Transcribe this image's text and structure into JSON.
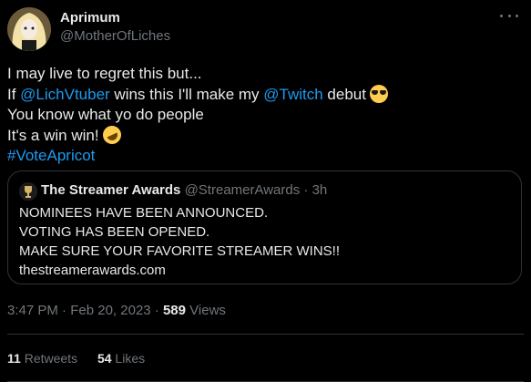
{
  "author": {
    "name": "Aprimum",
    "handle": "@MotherOfLiches"
  },
  "tweet": {
    "line1": "I may live to regret this but...",
    "line2_pre": "If ",
    "line2_link1": "@LichVtuber",
    "line2_mid": " wins this I'll make my ",
    "line2_link2": "@Twitch",
    "line2_post": " debut",
    "line3": "You know what yo do people",
    "line4": "It's a win win!",
    "hashtag": "#VoteApricot"
  },
  "emojis": {
    "cool": "smiling-face-with-sunglasses-icon",
    "laugh": "rolling-on-floor-laughing-icon"
  },
  "quote": {
    "name": "The Streamer Awards",
    "handle": "@StreamerAwards",
    "separator": "·",
    "time": "3h",
    "lines": [
      "NOMINEES HAVE BEEN ANNOUNCED.",
      "VOTING HAS BEEN OPENED.",
      "MAKE SURE YOUR FAVORITE STREAMER WINS!!",
      "thestreamerawards.com"
    ]
  },
  "meta": {
    "time": "3:47 PM",
    "separator": "·",
    "date": "Feb 20, 2023",
    "views_count": "589",
    "views_label": "Views"
  },
  "stats": {
    "retweets_count": "11",
    "retweets_label": "Retweets",
    "likes_count": "54",
    "likes_label": "Likes"
  },
  "colors": {
    "background": "#000000",
    "text": "#e7e9ea",
    "secondary": "#71767b",
    "link": "#1d9bf0",
    "border": "#2f3336"
  }
}
